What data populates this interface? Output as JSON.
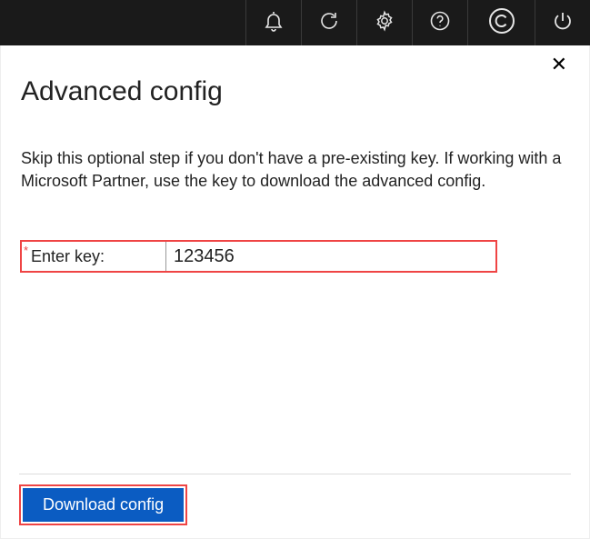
{
  "toolbar": {
    "icons": {
      "bell": "bell-icon",
      "refresh": "refresh-icon",
      "settings": "gear-icon",
      "help": "help-icon",
      "copyright": "copyright-icon",
      "power": "power-icon"
    }
  },
  "dialog": {
    "close_label": "✕",
    "title": "Advanced config",
    "description": "Skip this optional step if you don't have a pre-existing key. If working with a Microsoft Partner, use the key to download the advanced config.",
    "field": {
      "required_mark": "*",
      "label": "Enter key:",
      "value": "123456",
      "placeholder": ""
    },
    "download_button": "Download config"
  },
  "colors": {
    "topbar_bg": "#1a1a1a",
    "highlight_border": "#ef4444",
    "primary_button": "#0b5cc2"
  }
}
